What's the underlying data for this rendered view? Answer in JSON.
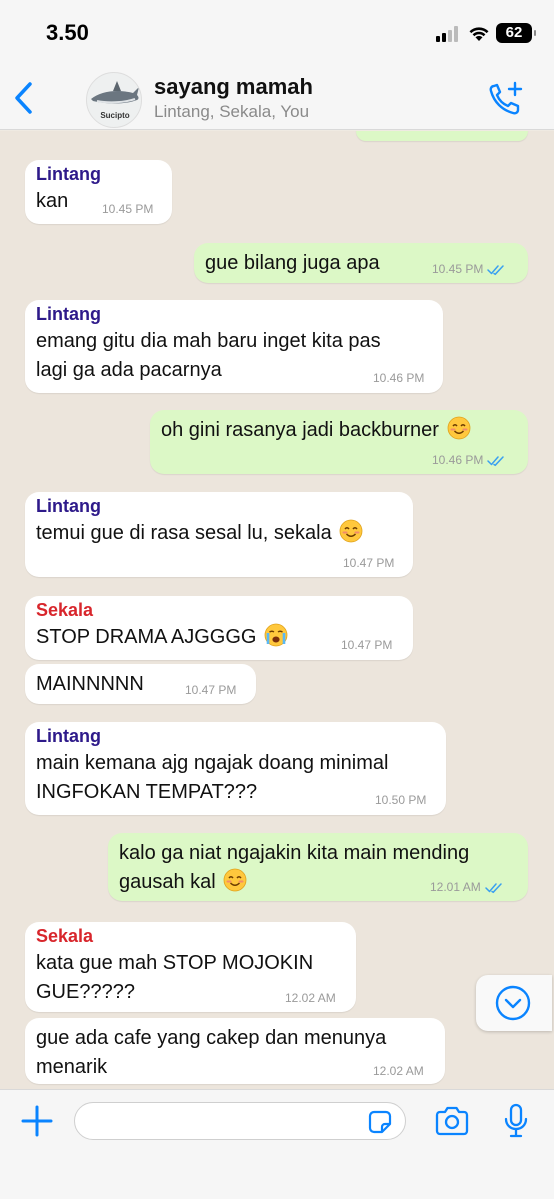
{
  "status_bar": {
    "time": "3.50",
    "battery": "62"
  },
  "header": {
    "group_name": "sayang mamah",
    "members": "Lintang, Sekala, You",
    "avatar_caption": "Sucipto"
  },
  "messages": [
    {
      "direction": "in",
      "sender": "Lintang",
      "text": "kan",
      "time": "10.45 PM"
    },
    {
      "direction": "out",
      "text": "gue bilang juga apa",
      "time": "10.45 PM",
      "read": true
    },
    {
      "direction": "in",
      "sender": "Lintang",
      "text": "emang gitu dia mah baru inget kita pas\nlagi ga ada pacarnya",
      "time": "10.46 PM"
    },
    {
      "direction": "out",
      "text": "oh gini rasanya jadi backburner",
      "emoji": "smiling-face",
      "time": "10.46 PM",
      "read": true
    },
    {
      "direction": "in",
      "sender": "Lintang",
      "text": "temui gue di rasa sesal lu, sekala",
      "emoji": "smiling-face",
      "time": "10.47 PM"
    },
    {
      "direction": "in",
      "sender": "Sekala",
      "text": "STOP DRAMA AJGGGG",
      "emoji": "crying-face",
      "time": "10.47 PM"
    },
    {
      "direction": "in",
      "text": "MAINNNNN",
      "time": "10.47 PM"
    },
    {
      "direction": "in",
      "sender": "Lintang",
      "text": "main kemana ajg ngajak doang minimal\nINGFOKAN TEMPAT???",
      "time": "10.50 PM"
    },
    {
      "direction": "out",
      "text": "kalo ga niat ngajakin kita main mending\ngausah kal",
      "emoji": "smiling-face",
      "time": "12.01 AM",
      "read": true
    },
    {
      "direction": "in",
      "sender": "Sekala",
      "text": "kata gue mah STOP MOJOKIN\nGUE?????",
      "time": "12.02 AM"
    },
    {
      "direction": "in",
      "text": "gue ada cafe yang cakep dan menunya\nmenarik",
      "time": "12.02 AM"
    }
  ],
  "composer": {
    "placeholder": ""
  },
  "colors": {
    "accent": "#0a84ff",
    "incoming_bubble": "#ffffff",
    "outgoing_bubble": "#dcf8c6",
    "chat_background": "#ece5dc",
    "sender_lintang": "#2e1a8a",
    "sender_sekala": "#d8262c",
    "read_ticks": "#3aa0f0"
  },
  "icons": {
    "back": "chevron-left-icon",
    "add_call": "phone-plus-icon",
    "plus": "plus-icon",
    "sticker": "sticker-icon",
    "camera": "camera-icon",
    "mic": "microphone-icon",
    "scroll_down": "chevron-down-circle-icon"
  }
}
